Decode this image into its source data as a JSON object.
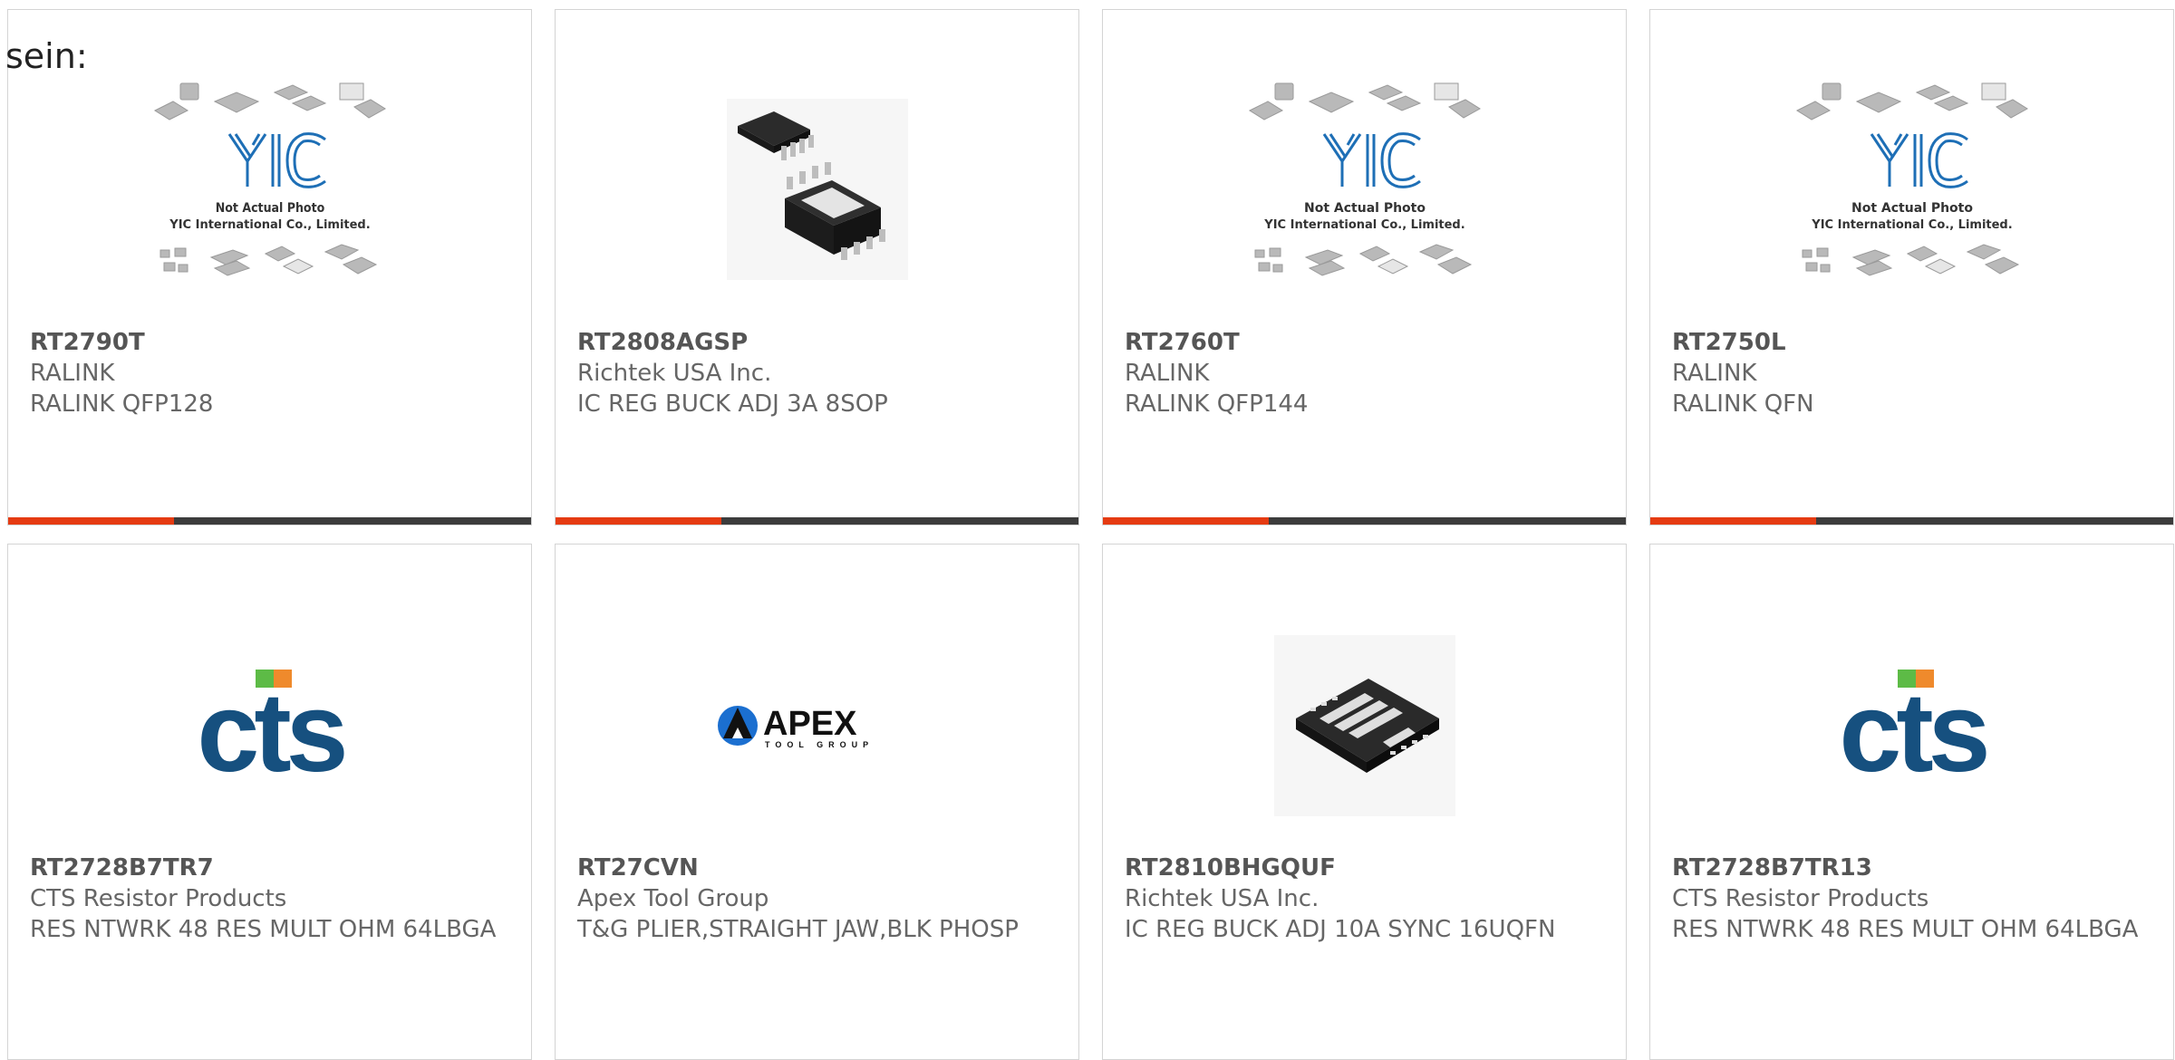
{
  "page": {
    "overlay_text": "sein:"
  },
  "products": [
    {
      "part_number": "RT2790T",
      "manufacturer": "RALINK",
      "description": "RALINK QFP128",
      "image": "yic-placeholder"
    },
    {
      "part_number": "RT2808AGSP",
      "manufacturer": "Richtek USA Inc.",
      "description": "IC REG BUCK ADJ 3A 8SOP",
      "image": "msop-chip"
    },
    {
      "part_number": "RT2760T",
      "manufacturer": "RALINK",
      "description": "RALINK QFP144",
      "image": "yic-placeholder"
    },
    {
      "part_number": "RT2750L",
      "manufacturer": "RALINK",
      "description": "RALINK QFN",
      "image": "yic-placeholder"
    },
    {
      "part_number": "RT2728B7TR7",
      "manufacturer": "CTS Resistor Products",
      "description": "RES NTWRK 48 RES MULT OHM 64LBGA",
      "image": "cts-logo"
    },
    {
      "part_number": "RT27CVN",
      "manufacturer": "Apex Tool Group",
      "description": "T&G PLIER,STRAIGHT JAW,BLK PHOSP",
      "image": "apex-logo"
    },
    {
      "part_number": "RT2810BHGQUF",
      "manufacturer": "Richtek USA Inc.",
      "description": "IC REG BUCK ADJ 10A SYNC 16UQFN",
      "image": "uqfn-chip"
    },
    {
      "part_number": "RT2728B7TR13",
      "manufacturer": "CTS Resistor Products",
      "description": "RES NTWRK 48 RES MULT OHM 64LBGA",
      "image": "cts-logo"
    }
  ],
  "placeholder_image": {
    "line1": "Not Actual Photo",
    "line2": "YIC International Co., Limited.",
    "logo": "YIC"
  },
  "logos": {
    "cts": "cts",
    "apex": "APEX",
    "apex_sub": "TOOL GROUP"
  },
  "colors": {
    "accent": "#e53b12",
    "bar": "#3c3c3c",
    "cts_blue": "#16507f"
  }
}
